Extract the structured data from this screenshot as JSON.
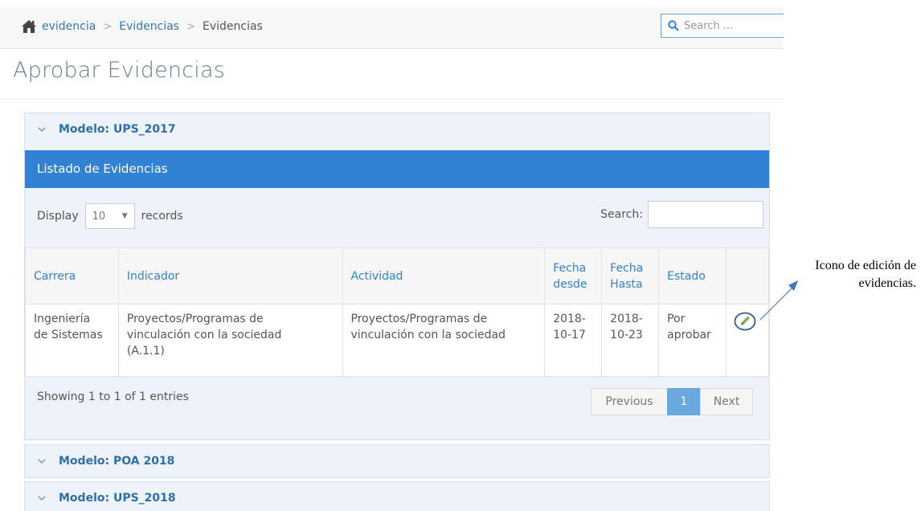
{
  "breadcrumb": {
    "icon": "home-icon",
    "items": [
      "evidencia",
      "Evidencias",
      "Evidencias"
    ]
  },
  "search": {
    "placeholder": "Search ...",
    "icon": "search-icon"
  },
  "page_title": "Aprobar Evidencias",
  "panels": [
    {
      "label": "Modelo: UPS_2017",
      "expanded": true
    },
    {
      "label": "Modelo: POA 2018",
      "expanded": false
    },
    {
      "label": "Modelo: UPS_2018",
      "expanded": false
    }
  ],
  "listing": {
    "header": "Listado de Evidencias",
    "display_label": "Display",
    "records_value": "10",
    "records_label": "records",
    "search_label": "Search:",
    "search_value": "",
    "columns": {
      "carrera": "Carrera",
      "indicador": "Indicador",
      "actividad": "Actividad",
      "fecha_desde_1": "Fecha",
      "fecha_desde_2": "desde",
      "fecha_hasta_1": "Fecha",
      "fecha_hasta_2": "Hasta",
      "estado": "Estado"
    },
    "rows": [
      {
        "carrera_1": "Ingeniería",
        "carrera_2": "de Sistemas",
        "indicador_1": "Proyectos/Programas de",
        "indicador_2": "vinculación con la sociedad",
        "indicador_3": "(A.1.1)",
        "actividad_1": "Proyectos/Programas de",
        "actividad_2": "vinculación con la sociedad",
        "desde_1": "2018-",
        "desde_2": "10-17",
        "hasta_1": "2018-",
        "hasta_2": "10-23",
        "estado_1": "Por",
        "estado_2": "aprobar",
        "action_icon": "pencil-icon"
      }
    ],
    "info": "Showing 1 to 1 of 1 entries",
    "pagination": {
      "previous": "Previous",
      "current": "1",
      "next": "Next"
    }
  },
  "annotation": {
    "line1": "Icono de edición de",
    "line2": "evidencias."
  },
  "colors": {
    "accent": "#3182d4",
    "link": "#2f6fab",
    "panel_bg": "#eef3f9",
    "edit_icon": "#7cb342"
  }
}
